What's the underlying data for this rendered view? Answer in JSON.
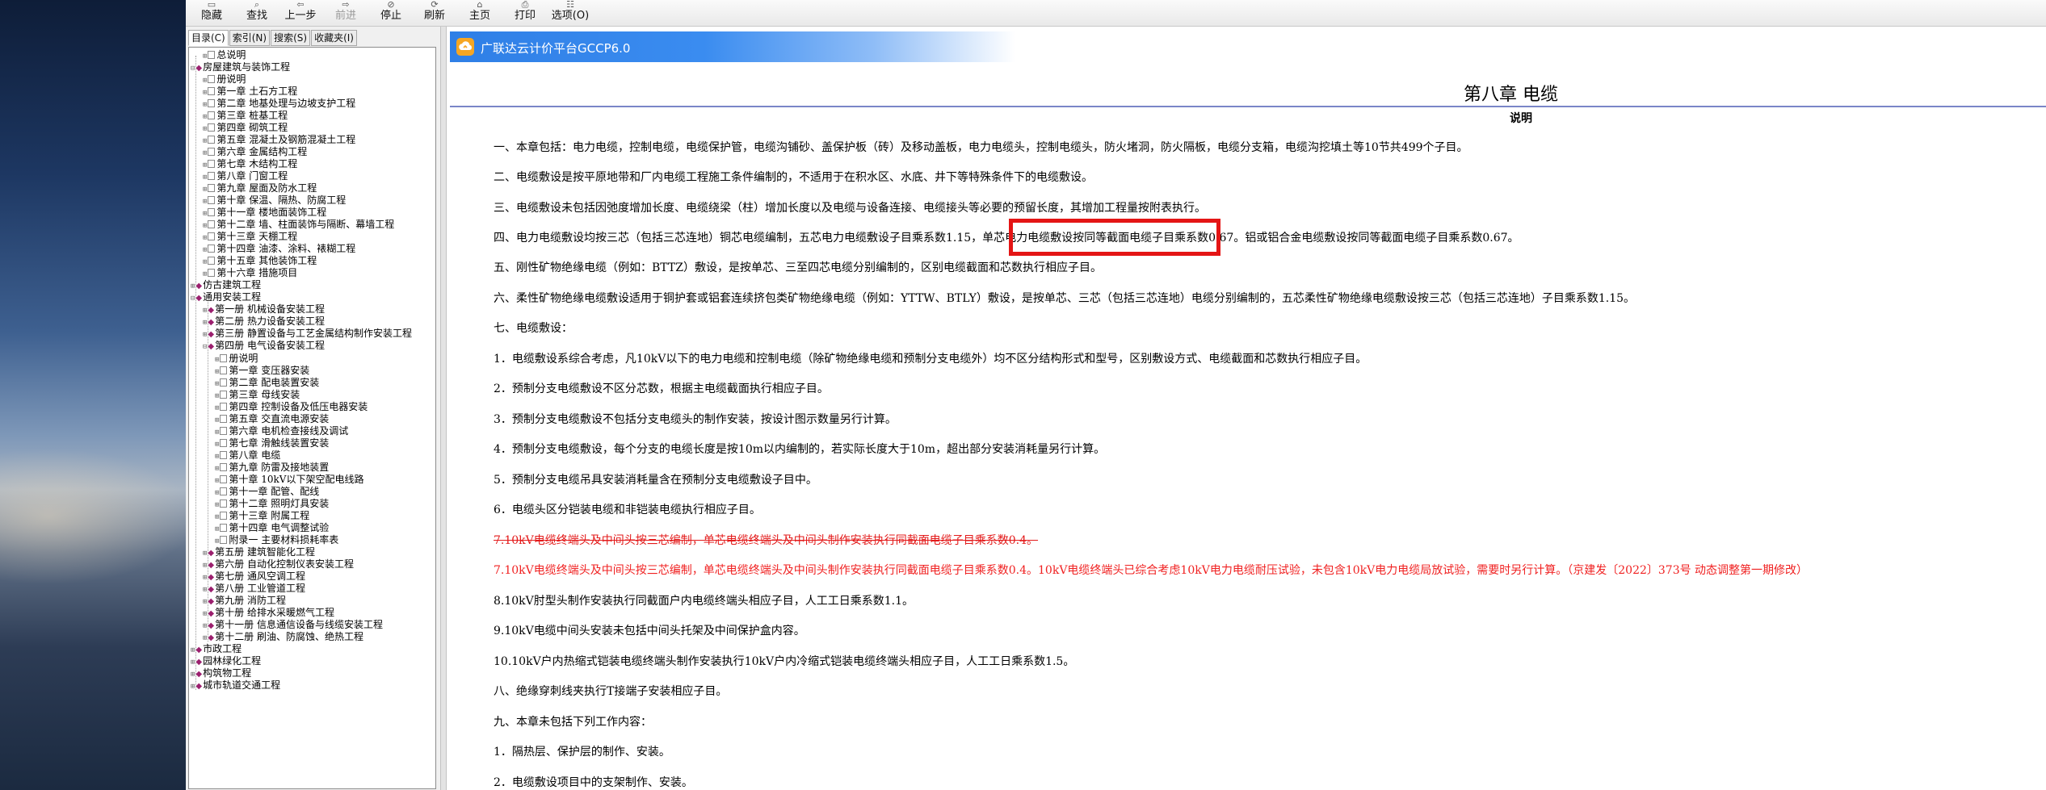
{
  "toolbar": {
    "buttons": [
      {
        "label": "隐藏",
        "icon": "hide-icon"
      },
      {
        "label": "查找",
        "icon": "find-icon"
      },
      {
        "label": "上一步",
        "icon": "back-icon"
      },
      {
        "label": "前进",
        "icon": "forward-icon",
        "disabled": true
      },
      {
        "label": "停止",
        "icon": "stop-icon"
      },
      {
        "label": "刷新",
        "icon": "refresh-icon"
      },
      {
        "label": "主页",
        "icon": "home-icon"
      },
      {
        "label": "打印",
        "icon": "print-icon"
      },
      {
        "label": "选项(O)",
        "icon": "options-icon"
      }
    ]
  },
  "nav": {
    "tabs": [
      "目录(C)",
      "索引(N)",
      "搜索(S)",
      "收藏夹(I)"
    ],
    "tree": [
      {
        "label": "总说明",
        "level": 1,
        "kind": "page"
      },
      {
        "label": "房屋建筑与装饰工程",
        "level": 0,
        "kind": "book-open"
      },
      {
        "label": "册说明",
        "level": 1,
        "kind": "page"
      },
      {
        "label": "第一章  土石方工程",
        "level": 1,
        "kind": "page"
      },
      {
        "label": "第二章  地基处理与边坡支护工程",
        "level": 1,
        "kind": "page"
      },
      {
        "label": "第三章  桩基工程",
        "level": 1,
        "kind": "page"
      },
      {
        "label": "第四章  砌筑工程",
        "level": 1,
        "kind": "page"
      },
      {
        "label": "第五章  混凝土及钢筋混凝土工程",
        "level": 1,
        "kind": "page"
      },
      {
        "label": "第六章  金属结构工程",
        "level": 1,
        "kind": "page"
      },
      {
        "label": "第七章  木结构工程",
        "level": 1,
        "kind": "page"
      },
      {
        "label": "第八章  门窗工程",
        "level": 1,
        "kind": "page"
      },
      {
        "label": "第九章  屋面及防水工程",
        "level": 1,
        "kind": "page"
      },
      {
        "label": "第十章  保温、隔热、防腐工程",
        "level": 1,
        "kind": "page"
      },
      {
        "label": "第十一章  楼地面装饰工程",
        "level": 1,
        "kind": "page"
      },
      {
        "label": "第十二章  墙、柱面装饰与隔断、幕墙工程",
        "level": 1,
        "kind": "page"
      },
      {
        "label": "第十三章  天棚工程",
        "level": 1,
        "kind": "page"
      },
      {
        "label": "第十四章  油漆、涂料、裱糊工程",
        "level": 1,
        "kind": "page"
      },
      {
        "label": "第十五章  其他装饰工程",
        "level": 1,
        "kind": "page"
      },
      {
        "label": "第十六章  措施项目",
        "level": 1,
        "kind": "page"
      },
      {
        "label": "仿古建筑工程",
        "level": 0,
        "kind": "book"
      },
      {
        "label": "通用安装工程",
        "level": 0,
        "kind": "book-open"
      },
      {
        "label": "第一册  机械设备安装工程",
        "level": 1,
        "kind": "book"
      },
      {
        "label": "第二册  热力设备安装工程",
        "level": 1,
        "kind": "book"
      },
      {
        "label": "第三册  静置设备与工艺金属结构制作安装工程",
        "level": 1,
        "kind": "book"
      },
      {
        "label": "第四册  电气设备安装工程",
        "level": 1,
        "kind": "book-open"
      },
      {
        "label": "册说明",
        "level": 2,
        "kind": "page"
      },
      {
        "label": "第一章  变压器安装",
        "level": 2,
        "kind": "page"
      },
      {
        "label": "第二章  配电装置安装",
        "level": 2,
        "kind": "page"
      },
      {
        "label": "第三章  母线安装",
        "level": 2,
        "kind": "page"
      },
      {
        "label": "第四章  控制设备及低压电器安装",
        "level": 2,
        "kind": "page"
      },
      {
        "label": "第五章  交直流电源安装",
        "level": 2,
        "kind": "page"
      },
      {
        "label": "第六章  电机检查接线及调试",
        "level": 2,
        "kind": "page"
      },
      {
        "label": "第七章  滑触线装置安装",
        "level": 2,
        "kind": "page"
      },
      {
        "label": "第八章  电缆",
        "level": 2,
        "kind": "page"
      },
      {
        "label": "第九章  防雷及接地装置",
        "level": 2,
        "kind": "page"
      },
      {
        "label": "第十章  10kV以下架空配电线路",
        "level": 2,
        "kind": "page"
      },
      {
        "label": "第十一章  配管、配线",
        "level": 2,
        "kind": "page"
      },
      {
        "label": "第十二章  照明灯具安装",
        "level": 2,
        "kind": "page"
      },
      {
        "label": "第十三章  附属工程",
        "level": 2,
        "kind": "page"
      },
      {
        "label": "第十四章  电气调整试验",
        "level": 2,
        "kind": "page"
      },
      {
        "label": "附录一  主要材料损耗率表",
        "level": 2,
        "kind": "page"
      },
      {
        "label": "第五册  建筑智能化工程",
        "level": 1,
        "kind": "book"
      },
      {
        "label": "第六册  自动化控制仪表安装工程",
        "level": 1,
        "kind": "book"
      },
      {
        "label": "第七册  通风空调工程",
        "level": 1,
        "kind": "book"
      },
      {
        "label": "第八册  工业管道工程",
        "level": 1,
        "kind": "book"
      },
      {
        "label": "第九册  消防工程",
        "level": 1,
        "kind": "book"
      },
      {
        "label": "第十册  给排水采暖燃气工程",
        "level": 1,
        "kind": "book"
      },
      {
        "label": "第十一册  信息通信设备与线缆安装工程",
        "level": 1,
        "kind": "book"
      },
      {
        "label": "第十二册  刷油、防腐蚀、绝热工程",
        "level": 1,
        "kind": "book"
      },
      {
        "label": "市政工程",
        "level": 0,
        "kind": "book"
      },
      {
        "label": "园林绿化工程",
        "level": 0,
        "kind": "book"
      },
      {
        "label": "构筑物工程",
        "level": 0,
        "kind": "book"
      },
      {
        "label": "城市轨道交通工程",
        "level": 0,
        "kind": "book"
      }
    ]
  },
  "content": {
    "banner_title": "广联达云计价平台GCCP6.0",
    "chapter_title": "第八章 电缆",
    "subtitle": "说明",
    "paragraphs": [
      {
        "text": "一、本章包括：电力电缆，控制电缆，电缆保护管，电缆沟铺砂、盖保护板（砖）及移动盖板，电力电缆头，控制电缆头，防火堵洞，防火隔板，电缆分支箱，电缆沟挖填土等10节共499个子目。",
        "style": "normal"
      },
      {
        "text": "二、电缆敷设是按平原地带和厂内电缆工程施工条件编制的，不适用于在积水区、水底、井下等特殊条件下的电缆敷设。",
        "style": "normal"
      },
      {
        "text": "三、电缆敷设未包括因弛度增加长度、电缆绕梁（柱）增加长度以及电缆与设备连接、电缆接头等必要的预留长度，其增加工程量按附表执行。",
        "style": "normal"
      },
      {
        "text": "四、电力电缆敷设均按三芯（包括三芯连地）铜芯电缆编制，五芯电力电缆敷设子目乘系数1.15，单芯电力电缆敷设按同等截面电缆子目乘系数0.67。铝或铝合金电缆敷设按同等截面电缆子目乘系数0.67。",
        "style": "normal"
      },
      {
        "text": "五、刚性矿物绝缘电缆（例如：BTTZ）敷设，是按单芯、三至四芯电缆分别编制的，区别电缆截面和芯数执行相应子目。",
        "style": "normal"
      },
      {
        "text": "六、柔性矿物绝缘电缆敷设适用于铜护套或铝套连续挤包类矿物绝缘电缆（例如：YTTW、BTLY）敷设，是按单芯、三芯（包括三芯连地）电缆分别编制的，五芯柔性矿物绝缘电缆敷设按三芯（包括三芯连地）子目乘系数1.15。",
        "style": "normal"
      },
      {
        "text": "七、电缆敷设：",
        "style": "normal"
      },
      {
        "text": "1．电缆敷设系综合考虑，凡10kV以下的电力电缆和控制电缆（除矿物绝缘电缆和预制分支电缆外）均不区分结构形式和型号，区别敷设方式、电缆截面和芯数执行相应子目。",
        "style": "normal"
      },
      {
        "text": "2．预制分支电缆敷设不区分芯数，根据主电缆截面执行相应子目。",
        "style": "normal"
      },
      {
        "text": "3．预制分支电缆敷设不包括分支电缆头的制作安装，按设计图示数量另行计算。",
        "style": "normal"
      },
      {
        "text": "4．预制分支电缆敷设，每个分支的电缆长度是按10m以内编制的，若实际长度大于10m，超出部分安装消耗量另行计算。",
        "style": "normal"
      },
      {
        "text": "5．预制分支电缆吊具安装消耗量含在预制分支电缆敷设子目中。",
        "style": "normal"
      },
      {
        "text": "6．电缆头区分铠装电缆和非铠装电缆执行相应子目。",
        "style": "normal"
      },
      {
        "text": "7.10kV电缆终端头及中间头按三芯编制，单芯电缆终端头及中间头制作安装执行同截面电缆子目乘系数0.4。",
        "style": "strike"
      },
      {
        "text": "7.10kV电缆终端头及中间头按三芯编制，单芯电缆终端头及中间头制作安装执行同截面电缆子目乘系数0.4。10kV电缆终端头已综合考虑10kV电力电缆耐压试验，未包含10kV电力电缆局放试验，需要时另行计算。（京建发〔2022〕373号 动态调整第一期修改）",
        "style": "red"
      },
      {
        "text": "8.10kV肘型头制作安装执行同截面户内电缆终端头相应子目，人工工日乘系数1.1。",
        "style": "normal"
      },
      {
        "text": "9.10kV电缆中间头安装未包括中间头托架及中间保护盒内容。",
        "style": "normal"
      },
      {
        "text": "10.10kV户内热缩式铠装电缆终端头制作安装执行10kV户内冷缩式铠装电缆终端头相应子目，人工工日乘系数1.5。",
        "style": "normal"
      },
      {
        "text": "八、绝缘穿刺线夹执行T接端子安装相应子目。",
        "style": "normal"
      },
      {
        "text": "九、本章未包括下列工作内容：",
        "style": "normal"
      },
      {
        "text": "1．隔热层、保护层的制作、安装。",
        "style": "normal"
      },
      {
        "text": "2．电缆敷设项目中的支架制作、安装。",
        "style": "normal"
      }
    ]
  },
  "colors": {
    "accent_blue": "#2f7fe6",
    "red_text": "#f02121",
    "highlight_box": "#e41515",
    "rule": "#7a86c8",
    "tree_book_icon": "#9b1f6e"
  }
}
